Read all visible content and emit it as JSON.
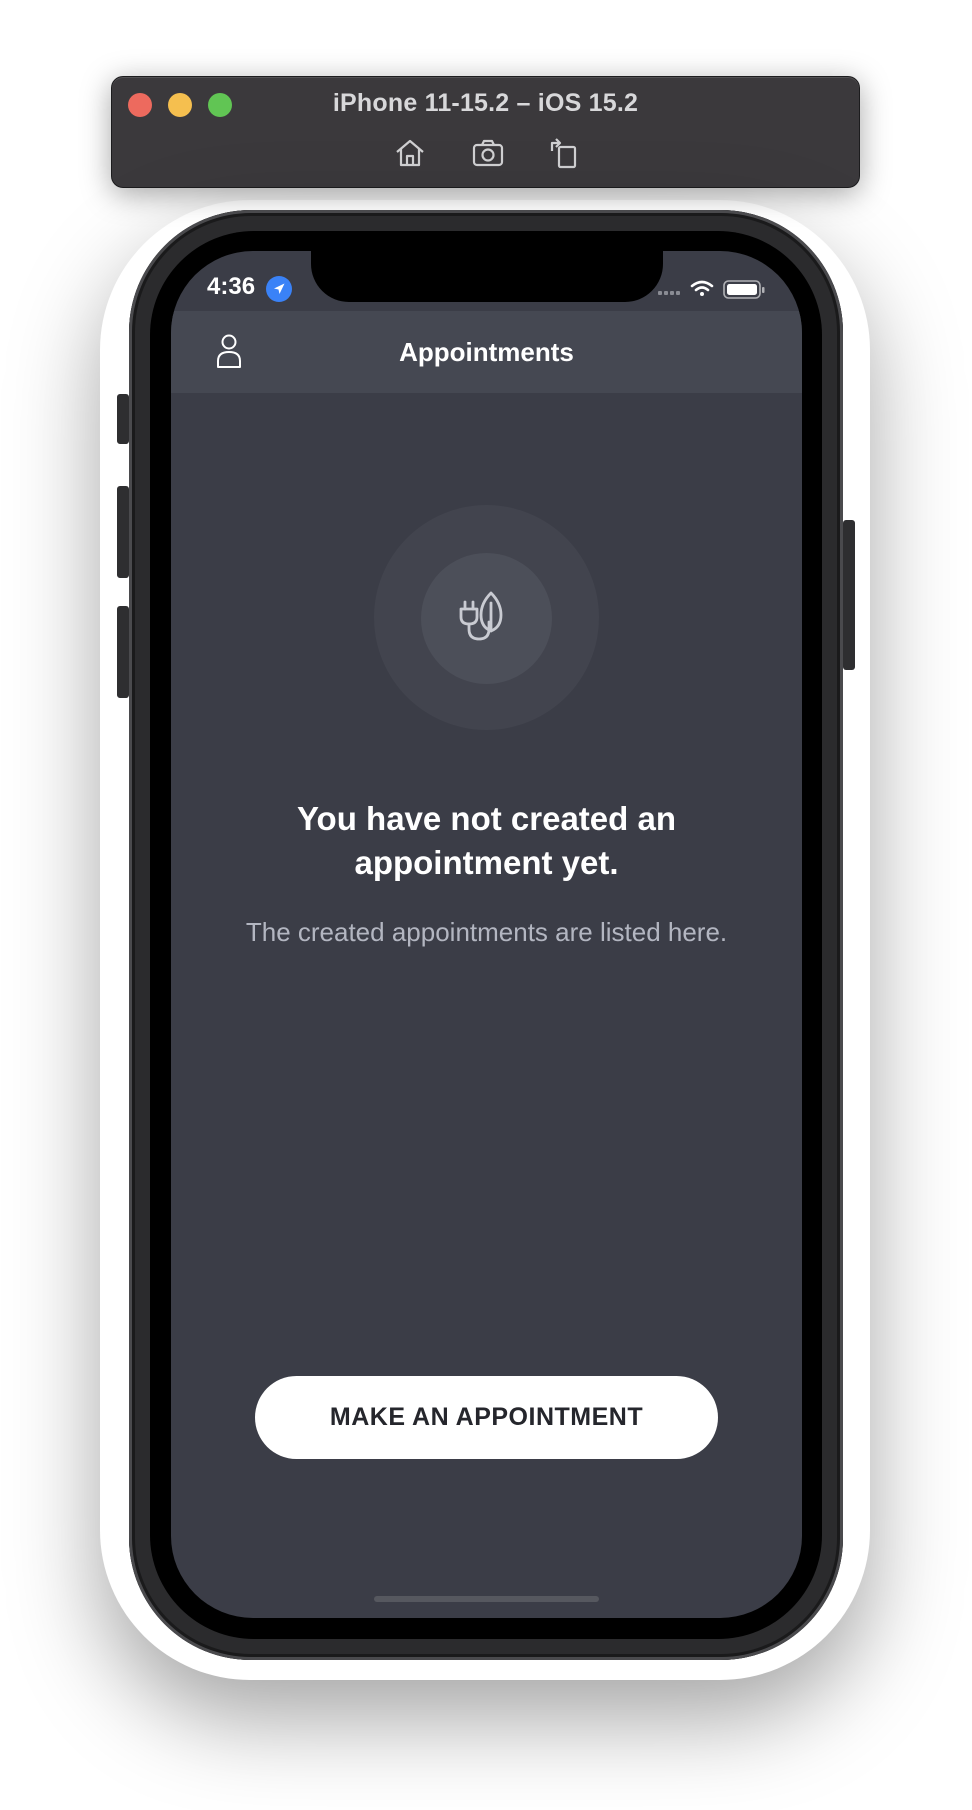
{
  "simulator": {
    "title": "iPhone 11-15.2 – iOS 15.2",
    "tools": [
      "home-icon",
      "screenshot-icon",
      "rotate-icon"
    ]
  },
  "status_bar": {
    "time": "4:36",
    "icons": [
      "location-arrow-icon",
      "cellular-icon",
      "wifi-icon",
      "battery-icon"
    ]
  },
  "nav": {
    "title": "Appointments",
    "left_icon": "profile-icon"
  },
  "empty_state": {
    "icon": "plug-leaf-icon",
    "title": "You have not created an appointment yet.",
    "subtitle": "The created appointments are listed here."
  },
  "cta": {
    "label": "MAKE AN APPOINTMENT"
  },
  "colors": {
    "screen_bg": "#3b3d47",
    "nav_bg": "#454852",
    "button_bg": "#ffffff",
    "location_badge": "#3a82f7"
  }
}
